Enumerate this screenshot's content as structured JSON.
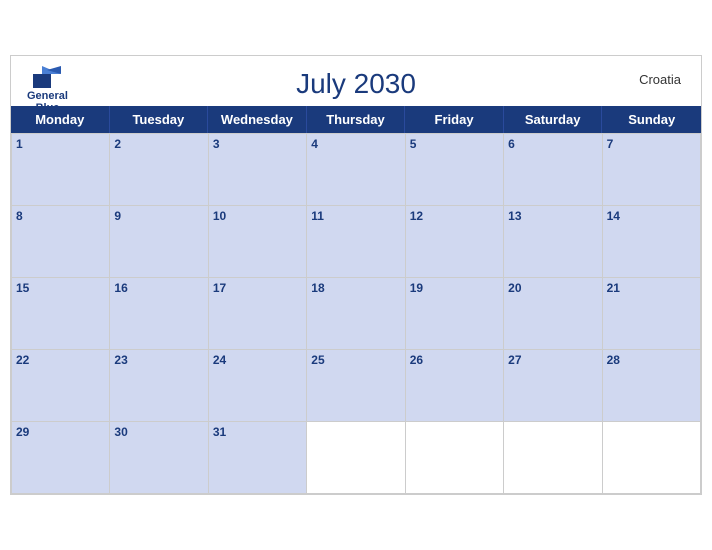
{
  "calendar": {
    "title": "July 2030",
    "country": "Croatia",
    "logo": {
      "line1": "General",
      "line2": "Blue"
    },
    "days": [
      "Monday",
      "Tuesday",
      "Wednesday",
      "Thursday",
      "Friday",
      "Saturday",
      "Sunday"
    ],
    "weeks": [
      [
        {
          "num": "1",
          "hasDate": true
        },
        {
          "num": "2",
          "hasDate": true
        },
        {
          "num": "3",
          "hasDate": true
        },
        {
          "num": "4",
          "hasDate": true
        },
        {
          "num": "5",
          "hasDate": true
        },
        {
          "num": "6",
          "hasDate": true
        },
        {
          "num": "7",
          "hasDate": true
        }
      ],
      [
        {
          "num": "8",
          "hasDate": true
        },
        {
          "num": "9",
          "hasDate": true
        },
        {
          "num": "10",
          "hasDate": true
        },
        {
          "num": "11",
          "hasDate": true
        },
        {
          "num": "12",
          "hasDate": true
        },
        {
          "num": "13",
          "hasDate": true
        },
        {
          "num": "14",
          "hasDate": true
        }
      ],
      [
        {
          "num": "15",
          "hasDate": true
        },
        {
          "num": "16",
          "hasDate": true
        },
        {
          "num": "17",
          "hasDate": true
        },
        {
          "num": "18",
          "hasDate": true
        },
        {
          "num": "19",
          "hasDate": true
        },
        {
          "num": "20",
          "hasDate": true
        },
        {
          "num": "21",
          "hasDate": true
        }
      ],
      [
        {
          "num": "22",
          "hasDate": true
        },
        {
          "num": "23",
          "hasDate": true
        },
        {
          "num": "24",
          "hasDate": true
        },
        {
          "num": "25",
          "hasDate": true
        },
        {
          "num": "26",
          "hasDate": true
        },
        {
          "num": "27",
          "hasDate": true
        },
        {
          "num": "28",
          "hasDate": true
        }
      ],
      [
        {
          "num": "29",
          "hasDate": true
        },
        {
          "num": "30",
          "hasDate": true
        },
        {
          "num": "31",
          "hasDate": true
        },
        {
          "num": "",
          "hasDate": false
        },
        {
          "num": "",
          "hasDate": false
        },
        {
          "num": "",
          "hasDate": false
        },
        {
          "num": "",
          "hasDate": false
        }
      ]
    ]
  }
}
